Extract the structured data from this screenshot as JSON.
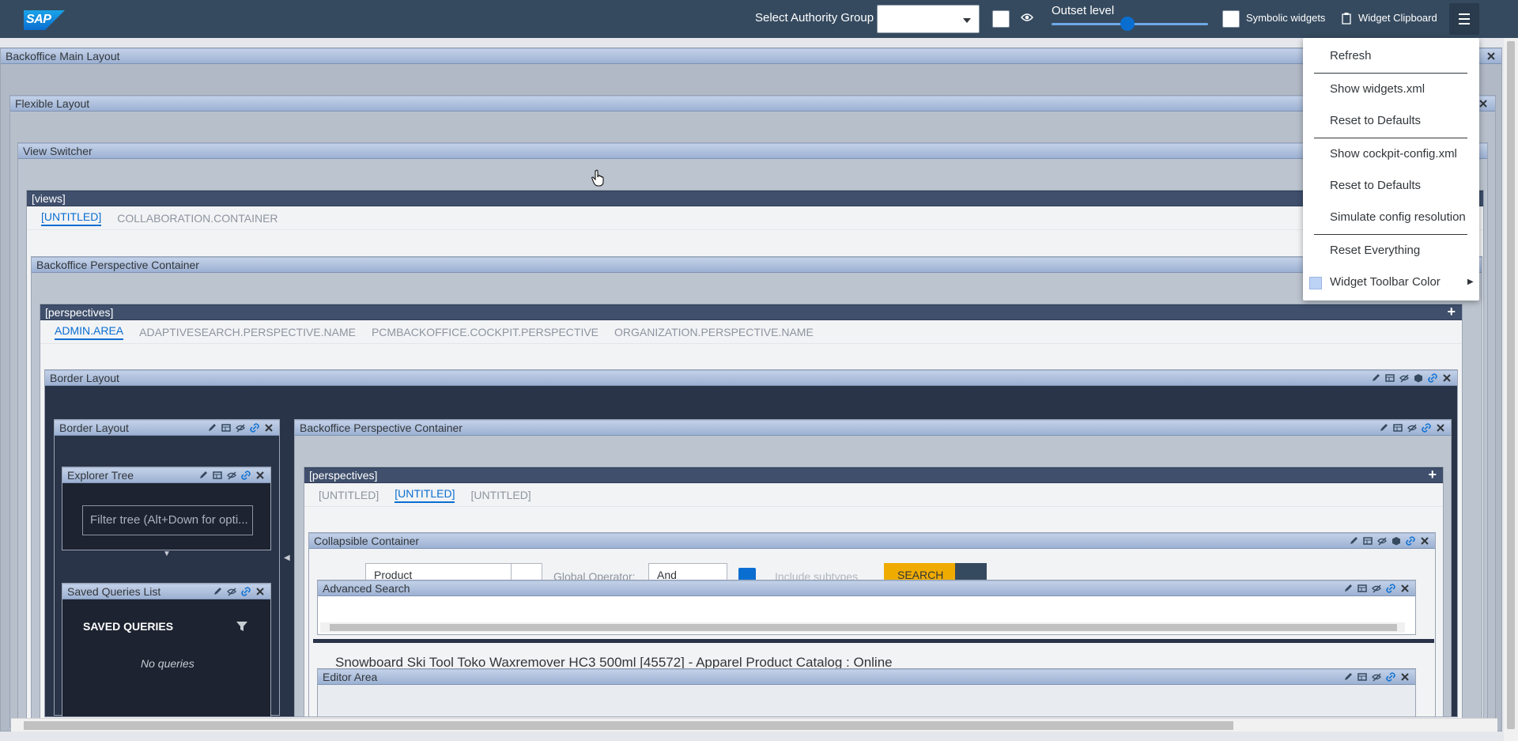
{
  "topbar": {
    "logo": "SAP",
    "authority_label": "Select Authority Group",
    "authority_value": "",
    "outset_label": "Outset level",
    "symbolic_label": "Symbolic widgets",
    "clipboard_label": "Widget Clipboard"
  },
  "menu": {
    "items": [
      "Refresh",
      "Show widgets.xml",
      "Reset to Defaults",
      "Show cockpit-config.xml",
      "Reset to Defaults",
      "Simulate config resolution",
      "Reset Everything",
      "Widget Toolbar Color"
    ]
  },
  "frames": {
    "main": "Backoffice Main Layout",
    "flexible": "Flexible Layout",
    "view_switcher": "View Switcher",
    "views": "[views]",
    "perspective_container": "Backoffice Perspective Container",
    "perspectives": "[perspectives]",
    "border_layout": "Border Layout",
    "border_layout_inner": "Border Layout",
    "explorer_tree": "Explorer Tree",
    "saved_queries_list": "Saved Queries List",
    "perspective_container_inner": "Backoffice Perspective Container",
    "perspectives_inner": "[perspectives]",
    "collapsible": "Collapsible Container",
    "advanced_search": "Advanced Search",
    "editor_area": "Editor Area"
  },
  "views_tabs": [
    "[UNTITLED]",
    "COLLABORATION.CONTAINER"
  ],
  "perspective_tabs": [
    "ADMIN.AREA",
    "ADAPTIVESEARCH.PERSPECTIVE.NAME",
    "PCMBACKOFFICE.COCKPIT.PERSPECTIVE",
    "ORGANIZATION.PERSPECTIVE.NAME"
  ],
  "inner_tabs": [
    "[UNTITLED]",
    "[UNTITLED]",
    "[UNTITLED]"
  ],
  "explorer": {
    "filter_placeholder": "Filter tree (Alt+Down for opti..."
  },
  "saved_queries": {
    "title": "SAVED QUERIES",
    "empty": "No queries"
  },
  "search": {
    "type_value": "Product",
    "operator_label": "Global Operator:",
    "operator_value": "And",
    "subtypes_label": "Include subtypes",
    "search_button": "SEARCH"
  },
  "editor": {
    "object_title": "Snowboard Ski Tool Toko Waxremover HC3 500ml [45572] - Apparel Product Catalog : Online"
  },
  "colors": {
    "topbar": "#354a5f",
    "accent": "#0a6ed1",
    "header": "#9cb1d3",
    "search_button": "#f0ab00"
  }
}
